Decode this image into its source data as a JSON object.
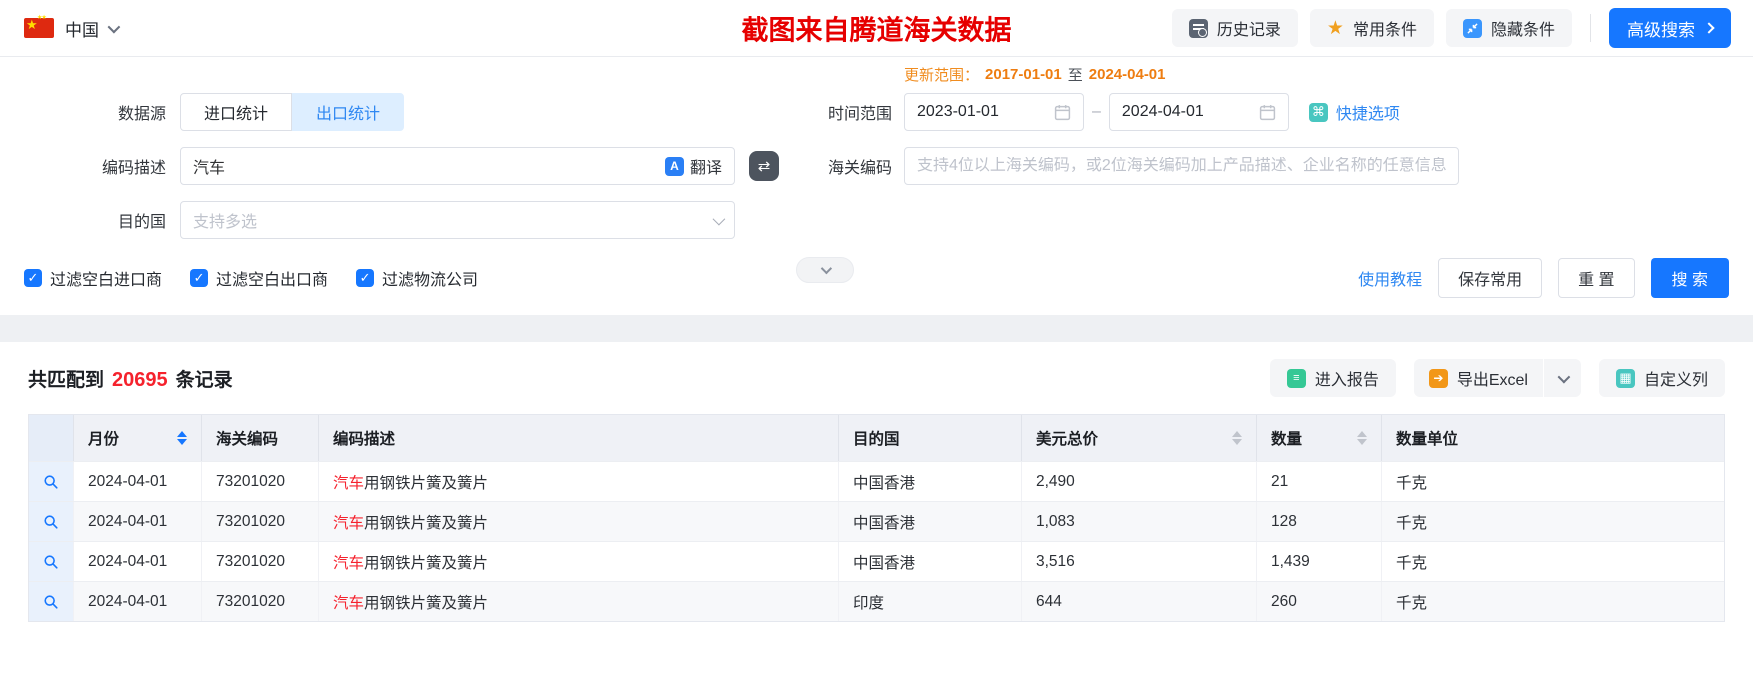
{
  "top_bar": {
    "country": "中国",
    "watermark": "截图来自腾道海关数据",
    "buttons": {
      "history": "历史记录",
      "favorites": "常用条件",
      "hide": "隐藏条件",
      "advanced": "高级搜索"
    }
  },
  "search_form": {
    "update_range": {
      "label": "更新范围：",
      "from": "2017-01-01",
      "to_word": "至",
      "to": "2024-04-01"
    },
    "data_source": {
      "label": "数据源",
      "import_tab": "进口统计",
      "export_tab": "出口统计"
    },
    "time_range": {
      "label": "时间范围",
      "start": "2023-01-01",
      "end": "2024-04-01",
      "separator": "–",
      "quick_options": "快捷选项"
    },
    "code_desc": {
      "label": "编码描述",
      "value": "汽车",
      "translate": "翻译"
    },
    "customs_code": {
      "label": "海关编码",
      "placeholder": "支持4位以上海关编码，或2位海关编码加上产品描述、企业名称的任意信息"
    },
    "destination": {
      "label": "目的国",
      "placeholder": "支持多选"
    },
    "filters": [
      "过滤空白进口商",
      "过滤空白出口商",
      "过滤物流公司"
    ],
    "tutorial": "使用教程",
    "save": "保存常用",
    "reset": "重 置",
    "search": "搜 索"
  },
  "results": {
    "match_prefix": "共匹配到",
    "match_count": "20695",
    "match_suffix": "条记录",
    "report": "进入报告",
    "export": "导出Excel",
    "customize": "自定义列",
    "table": {
      "columns": [
        "月份",
        "海关编码",
        "编码描述",
        "目的国",
        "美元总价",
        "数量",
        "数量单位"
      ],
      "rows": [
        {
          "month": "2024-04-01",
          "code": "73201020",
          "desc_hl": "汽车",
          "desc": "用钢铁片簧及簧片",
          "country": "中国香港",
          "usd": "2,490",
          "qty": "21",
          "unit": "千克"
        },
        {
          "month": "2024-04-01",
          "code": "73201020",
          "desc_hl": "汽车",
          "desc": "用钢铁片簧及簧片",
          "country": "中国香港",
          "usd": "1,083",
          "qty": "128",
          "unit": "千克"
        },
        {
          "month": "2024-04-01",
          "code": "73201020",
          "desc_hl": "汽车",
          "desc": "用钢铁片簧及簧片",
          "country": "中国香港",
          "usd": "3,516",
          "qty": "1,439",
          "unit": "千克"
        },
        {
          "month": "2024-04-01",
          "code": "73201020",
          "desc_hl": "汽车",
          "desc": "用钢铁片簧及簧片",
          "country": "印度",
          "usd": "644",
          "qty": "260",
          "unit": "千克"
        }
      ]
    }
  },
  "colors": {
    "accent": "#1677ff",
    "orange": "#ee7d11",
    "count_red": "#f5222d",
    "watermark_red": "#e60000"
  }
}
